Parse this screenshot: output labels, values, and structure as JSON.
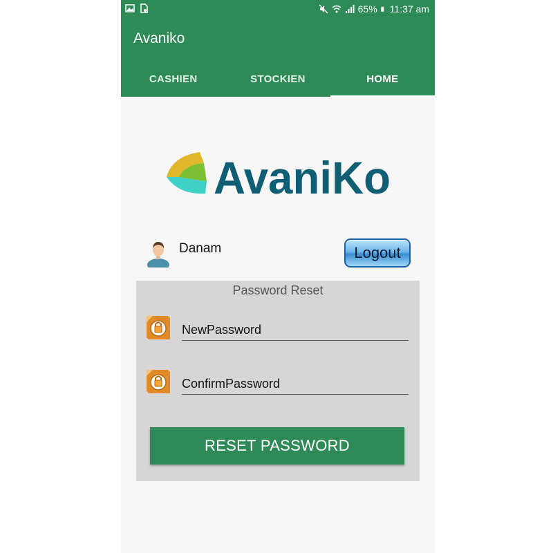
{
  "status_bar": {
    "left_icons": [
      "image-icon",
      "sim-icon"
    ],
    "right_icons": [
      "mute-icon",
      "wifi-icon",
      "signal-icon",
      "battery-icon"
    ],
    "battery": "65%",
    "time": "11:37 am"
  },
  "app": {
    "title": "Avaniko",
    "primary_color": "#2e8b57"
  },
  "tabs": [
    {
      "label": "CASHIEN",
      "active": false
    },
    {
      "label": "STOCKIEN",
      "active": false
    },
    {
      "label": "HOME",
      "active": true
    }
  ],
  "logo": {
    "text": "AvaniKo",
    "icon": "avaniko-logo-icon"
  },
  "user": {
    "name": "Danam",
    "avatar_icon": "user-avatar-icon"
  },
  "logout": {
    "label": "Logout"
  },
  "password_reset": {
    "title": "Password Reset",
    "new_password_placeholder": "NewPassword",
    "confirm_password_placeholder": "ConfirmPassword",
    "field_icon": "lock-icon",
    "button_label": "RESET PASSWORD"
  }
}
